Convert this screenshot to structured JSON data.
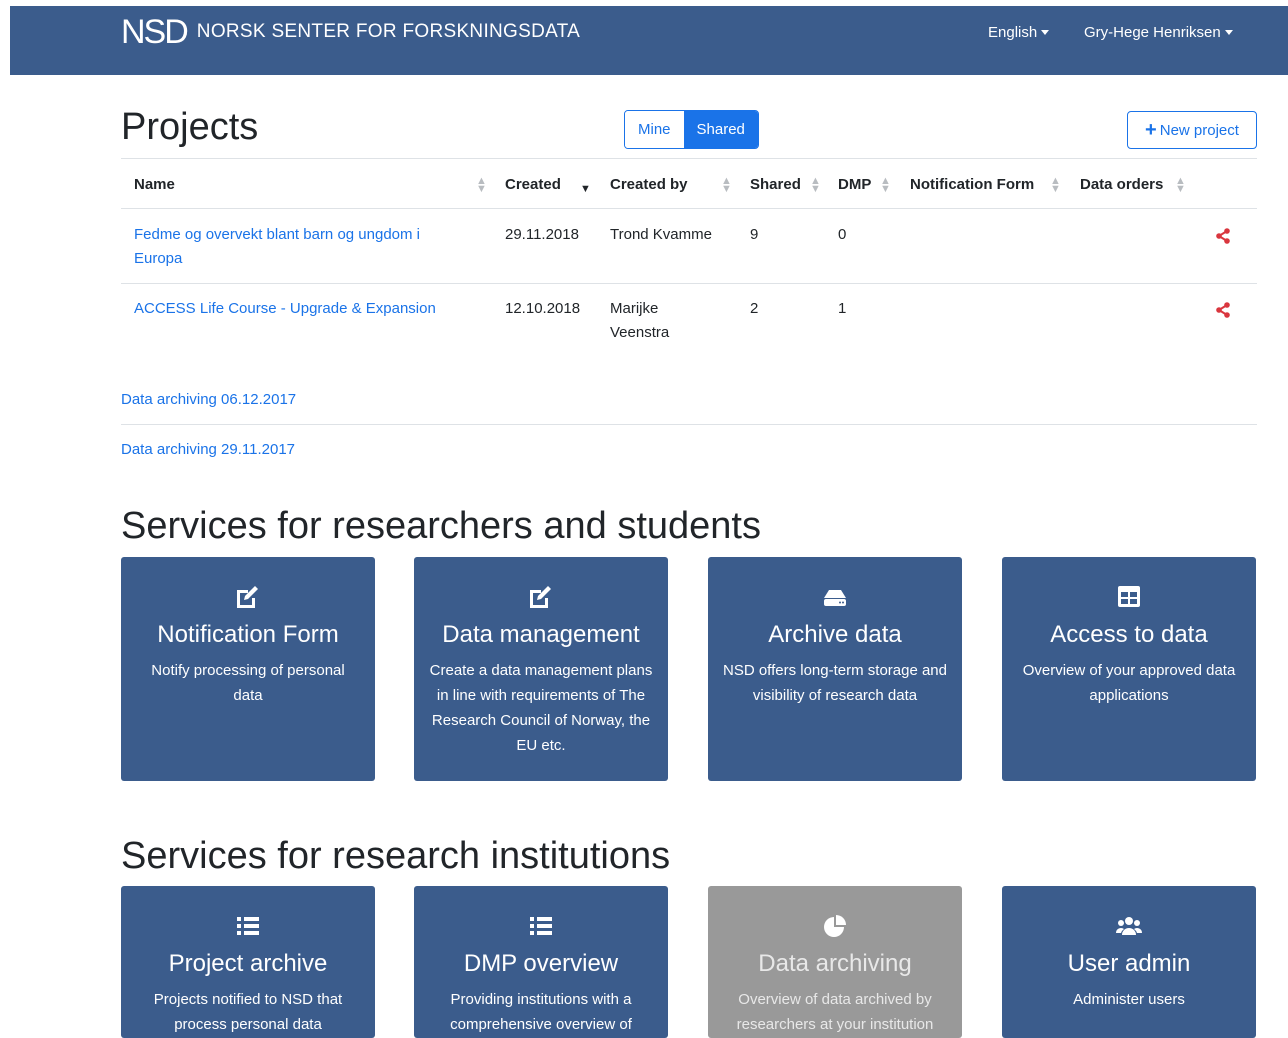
{
  "navbar": {
    "logo": "NSD",
    "org_name": "NORSK SENTER FOR FORSKNINGSDATA",
    "language": "English",
    "user": "Gry-Hege Henriksen"
  },
  "projects": {
    "title": "Projects",
    "toggle": {
      "mine": "Mine",
      "shared": "Shared",
      "active": "Shared"
    },
    "new_project": "New project",
    "columns": [
      "Name",
      "Created",
      "Created by",
      "Shared",
      "DMP",
      "Notification Form",
      "Data orders"
    ],
    "rows": [
      {
        "name": "Fedme og overvekt blant barn og ungdom i Europa",
        "created": "29.11.2018",
        "created_by": "Trond Kvamme",
        "shared": "9",
        "dmp": "0"
      },
      {
        "name": "ACCESS Life Course - Upgrade & Expansion",
        "created": "12.10.2018",
        "created_by": "Marijke Veenstra",
        "shared": "2",
        "dmp": "1"
      }
    ]
  },
  "archives": [
    "Data archiving 06.12.2017",
    "Data archiving 29.11.2017"
  ],
  "researchers_section": {
    "title": "Services for researchers and students",
    "cards": [
      {
        "icon": "edit-icon",
        "title": "Notification Form",
        "desc": "Notify processing of personal data"
      },
      {
        "icon": "edit-icon",
        "title": "Data management",
        "desc": "Create a data management plans in line with requirements of The Research Council of Norway, the EU etc."
      },
      {
        "icon": "hdd-icon",
        "title": "Archive data",
        "desc": "NSD offers long-term storage and visibility of research data"
      },
      {
        "icon": "table-icon",
        "title": "Access to data",
        "desc": "Overview of your approved data applications"
      }
    ]
  },
  "institutions_section": {
    "title": "Services for research institutions",
    "cards": [
      {
        "icon": "list-icon",
        "title": "Project archive",
        "desc": "Projects notified to NSD that process personal data"
      },
      {
        "icon": "list-icon",
        "title": "DMP overview",
        "desc": "Providing institutions with a comprehensive overview of"
      },
      {
        "icon": "pie-chart-icon",
        "title": "Data archiving",
        "desc": "Overview of data archived by researchers at your institution"
      },
      {
        "icon": "users-icon",
        "title": "User admin",
        "desc": "Administer users"
      }
    ]
  },
  "colors": {
    "navbar": "#3b5c8c",
    "link": "#1a73e8",
    "share": "#d9363e",
    "card": "#3b5c8c",
    "card_disabled": "#999999"
  }
}
